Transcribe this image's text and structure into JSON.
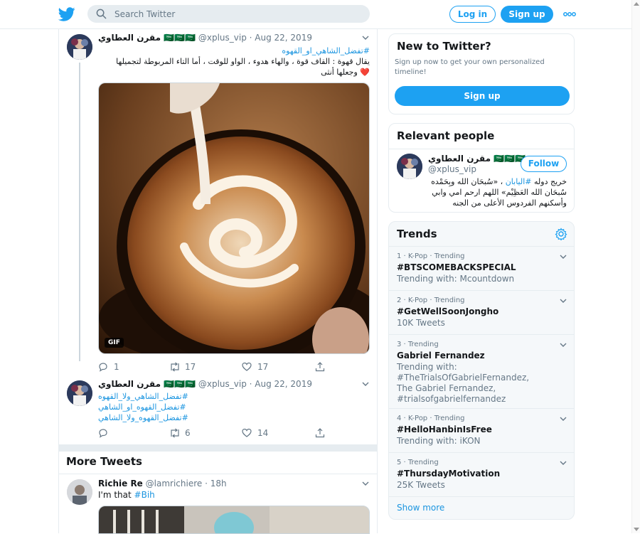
{
  "header": {
    "logo": "twitter-bird-icon",
    "search_placeholder": "Search Twitter",
    "login_label": "Log in",
    "signup_label": "Sign up",
    "more": "more-options-icon"
  },
  "colors": {
    "accent": "#1da1f2",
    "link": "#1b95e0",
    "muted": "#657786",
    "border": "#e6ecf0",
    "like": "#e0245e"
  },
  "thread": [
    {
      "name": "مقرن العطاوي 🇸🇦🇸🇦🇸🇦",
      "handle": "@xplus_vip",
      "date": "Aug 22, 2019",
      "hashtag": "#تفضل_الشاهي_او_القهوه",
      "text_line1": "يقال قهوة : القاف قوة ، والهاء هدوء ، الواو للوقت ، أما التاء المربوطة لتجميلها",
      "text_line2": "وجعلها أنثى",
      "gif_label": "GIF",
      "replies": "1",
      "retweets": "17",
      "likes": "17"
    },
    {
      "name": "مقرن العطاوي 🇸🇦🇸🇦🇸🇦",
      "handle": "@xplus_vip",
      "date": "Aug 22, 2019",
      "hashtags": [
        "#تفضل_الشاهي_ولا_القهوه",
        "#تفضل_القهوه_او_الشاهي",
        "#تفضل_القهوه_ولا_الشاهي"
      ],
      "retweets": "6",
      "likes": "14"
    }
  ],
  "more_tweets": {
    "title": "More Tweets",
    "tweet": {
      "name": "Richie Re",
      "handle": "@lamrichiere",
      "time": "18h",
      "text": "I'm that",
      "hashtag": "#Bih"
    }
  },
  "new_to_twitter": {
    "title": "New to Twitter?",
    "text": "Sign up now to get your own personalized timeline!",
    "button": "Sign up"
  },
  "relevant_people": {
    "title": "Relevant people",
    "name": "مقرن العطاوي 🇸🇦🇸🇦🇸🇦",
    "handle": "@xplus_vip",
    "follow": "Follow",
    "bio_line1_prefix": "خريج دوله ",
    "bio_line1_link": "#اليابان",
    "bio_line1_suffix": " ، «سُبحَان الله وبِحَمْده",
    "bio_line2": "سُبحَان الله العَظِيْم» اللهم ارحم امي وابي",
    "bio_line3": "وأسكنهم الفردوس الأعلى من الجنه"
  },
  "trends": {
    "title": "Trends",
    "settings": "gear-icon",
    "items": [
      {
        "meta": "1 · K-Pop · Trending",
        "name": "#BTSCOMEBACKSPECIAL",
        "sub": "Trending with: Mcountdown"
      },
      {
        "meta": "2 · K-Pop · Trending",
        "name": "#GetWellSoonJongho",
        "sub": "10K Tweets"
      },
      {
        "meta": "3 · Trending",
        "name": "Gabriel Fernandez",
        "sub": "Trending with: #TheTrialsOfGabrielFernandez, The Gabriel Fernandez, #trialsofgabrielfernandez"
      },
      {
        "meta": "4 · K-Pop · Trending",
        "name": "#HelloHanbinIsFree",
        "sub": "Trending with: iKON"
      },
      {
        "meta": "5 · Trending",
        "name": "#ThursdayMotivation",
        "sub": "25K Tweets"
      }
    ],
    "show_more": "Show more"
  }
}
